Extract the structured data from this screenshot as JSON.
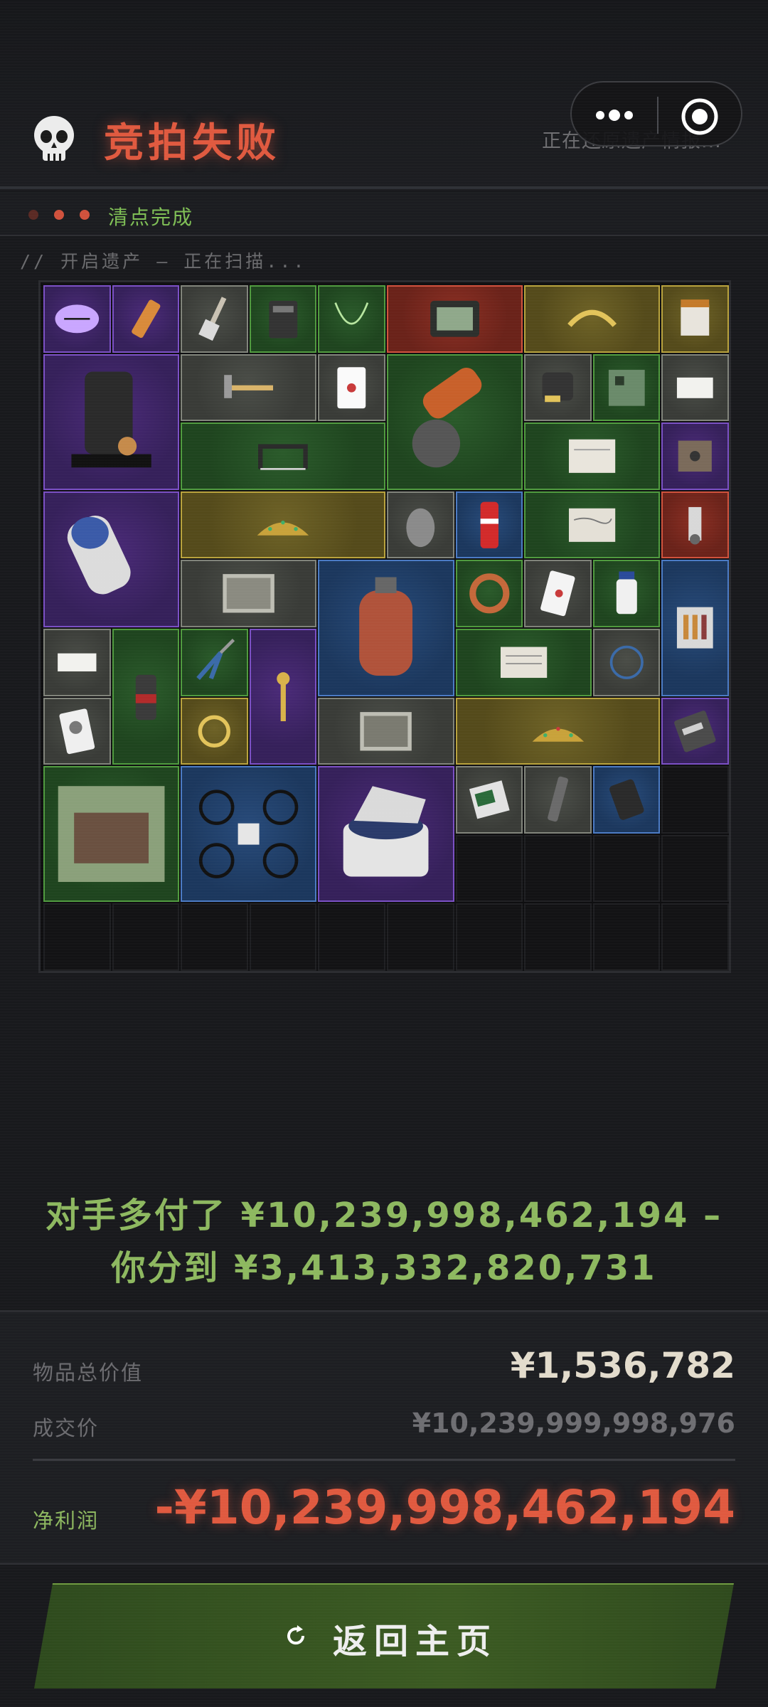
{
  "header": {
    "title": "竞拍失败",
    "restoring_text": "正在还原遗产情报...",
    "skull_icon": "skull-icon",
    "more_icon": "more-dots-icon",
    "close_icon": "target-circle-icon"
  },
  "status": {
    "label": "清点完成",
    "dot_colors": [
      "#5a2a24",
      "#d0513c",
      "#d0513c"
    ]
  },
  "scan_text": "// 开启遗产 – 正在扫描...",
  "inventory": {
    "grid_columns": 10,
    "grid_rows": 10,
    "items": [
      {
        "name": "rugby-ball",
        "rarity": "purple"
      },
      {
        "name": "firecracker",
        "rarity": "purple"
      },
      {
        "name": "paint-brush",
        "rarity": "gray"
      },
      {
        "name": "battery",
        "rarity": "green"
      },
      {
        "name": "necklace",
        "rarity": "green"
      },
      {
        "name": "tablet-case",
        "rarity": "red"
      },
      {
        "name": "laurel-crown",
        "rarity": "gold"
      },
      {
        "name": "food-pack",
        "rarity": "gold"
      },
      {
        "name": "coffee-machine",
        "rarity": "purple"
      },
      {
        "name": "hammer",
        "rarity": "gray"
      },
      {
        "name": "playing-card",
        "rarity": "gray"
      },
      {
        "name": "angle-grinder",
        "rarity": "green"
      },
      {
        "name": "tape-measure",
        "rarity": "gray"
      },
      {
        "name": "circuit-board",
        "rarity": "green"
      },
      {
        "name": "paper-note",
        "rarity": "gray"
      },
      {
        "name": "hacksaw",
        "rarity": "green"
      },
      {
        "name": "old-document",
        "rarity": "green"
      },
      {
        "name": "cassette",
        "rarity": "purple"
      },
      {
        "name": "telescope-device",
        "rarity": "purple"
      },
      {
        "name": "jeweled-tiara",
        "rarity": "gold"
      },
      {
        "name": "mouse",
        "rarity": "gray"
      },
      {
        "name": "soda-can",
        "rarity": "blue"
      },
      {
        "name": "handwritten-letter",
        "rarity": "green"
      },
      {
        "name": "spark-plug",
        "rarity": "red"
      },
      {
        "name": "photo-print",
        "rarity": "gray"
      },
      {
        "name": "gas-cylinder",
        "rarity": "blue"
      },
      {
        "name": "copper-coil",
        "rarity": "green"
      },
      {
        "name": "ace-card",
        "rarity": "gray"
      },
      {
        "name": "medicine-bottle",
        "rarity": "green"
      },
      {
        "name": "ammo-box",
        "rarity": "blue"
      },
      {
        "name": "napkin",
        "rarity": "gray"
      },
      {
        "name": "spray-can",
        "rarity": "green"
      },
      {
        "name": "pliers",
        "rarity": "green"
      },
      {
        "name": "gold-scepter",
        "rarity": "purple"
      },
      {
        "name": "sheet-music",
        "rarity": "green"
      },
      {
        "name": "network-cable",
        "rarity": "gray"
      },
      {
        "name": "portrait-card",
        "rarity": "gray"
      },
      {
        "name": "gold-bracelet",
        "rarity": "gold"
      },
      {
        "name": "photo-print-2",
        "rarity": "gray"
      },
      {
        "name": "jeweled-tiara-2",
        "rarity": "gold"
      },
      {
        "name": "hard-drive",
        "rarity": "purple"
      },
      {
        "name": "hotel-painting",
        "rarity": "green"
      },
      {
        "name": "drone",
        "rarity": "blue"
      },
      {
        "name": "centrifuge",
        "rarity": "purple"
      },
      {
        "name": "matchbox",
        "rarity": "gray"
      },
      {
        "name": "flashlight",
        "rarity": "gray"
      },
      {
        "name": "power-bank",
        "rarity": "blue"
      }
    ]
  },
  "result": {
    "line1": "对手多付了 ¥10,239,998,462,194 –",
    "line2": "你分到 ¥3,413,332,820,731"
  },
  "summary": {
    "total_label": "物品总价值",
    "total_value": "¥1,536,782",
    "price_label": "成交价",
    "price_value": "¥10,239,999,998,976",
    "profit_label": "净利润",
    "profit_value": "-¥10,239,998,462,194"
  },
  "home_button": {
    "label": "返回主页",
    "icon": "refresh-icon"
  },
  "colors": {
    "title_red": "#e0593f",
    "profit_red": "#e0593f",
    "accent_green": "#8db85f"
  }
}
